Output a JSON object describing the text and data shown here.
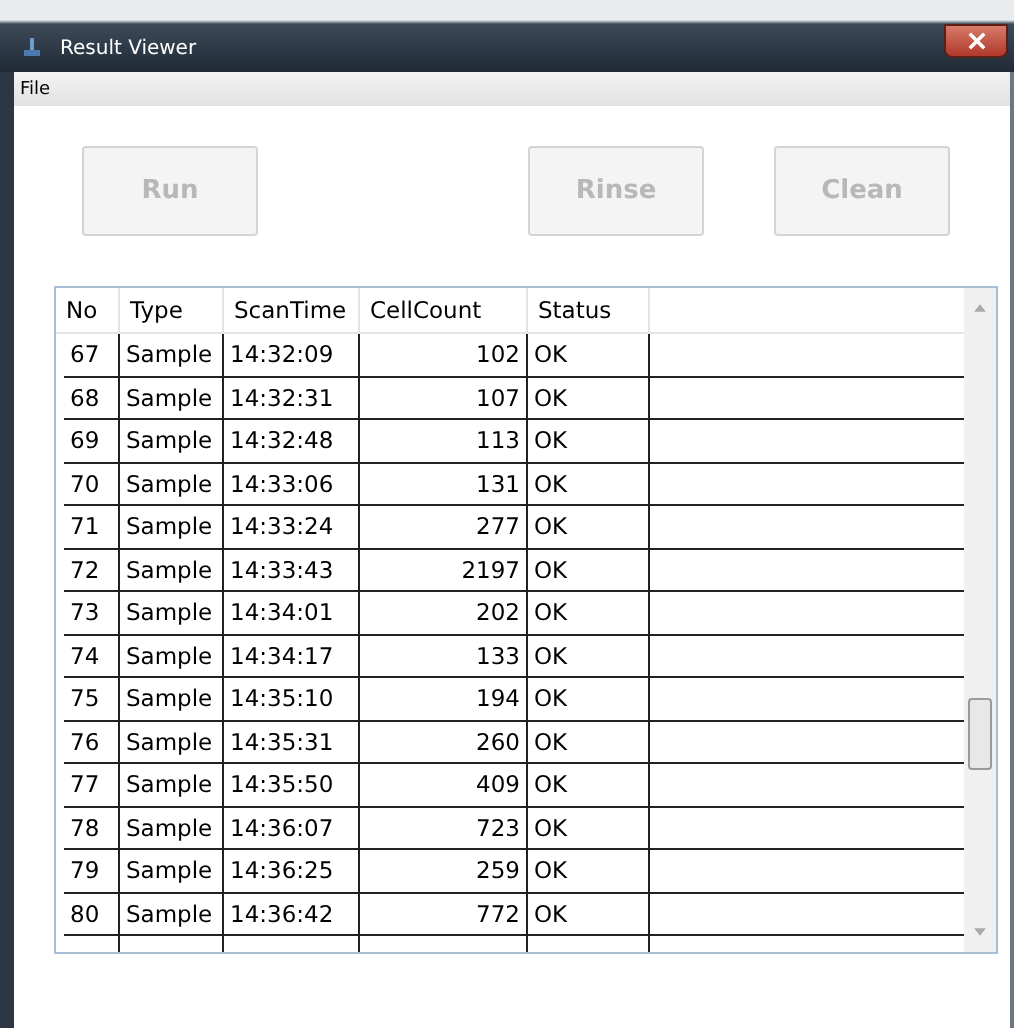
{
  "window": {
    "title": "Result Viewer"
  },
  "menu": [
    {
      "label": "File"
    }
  ],
  "buttons": [
    {
      "label": "Run",
      "disabled": true
    }
  ],
  "right_buttons": [
    {
      "label": "Rinse",
      "disabled": true
    },
    {
      "label": "Clean",
      "disabled": true
    }
  ],
  "table": {
    "columns": [
      "No",
      "Type",
      "ScanTime",
      "CellCount",
      "Status"
    ],
    "rows": [
      [
        "67",
        "Sample",
        "14:32:09",
        "102",
        "OK"
      ],
      [
        "68",
        "Sample",
        "14:32:31",
        "107",
        "OK"
      ],
      [
        "69",
        "Sample",
        "14:32:48",
        "113",
        "OK"
      ],
      [
        "70",
        "Sample",
        "14:33:06",
        "131",
        "OK"
      ],
      [
        "71",
        "Sample",
        "14:33:24",
        "277",
        "OK"
      ],
      [
        "72",
        "Sample",
        "14:33:43",
        "2197",
        "OK"
      ],
      [
        "73",
        "Sample",
        "14:34:01",
        "202",
        "OK"
      ],
      [
        "74",
        "Sample",
        "14:34:17",
        "133",
        "OK"
      ],
      [
        "75",
        "Sample",
        "14:35:10",
        "194",
        "OK"
      ],
      [
        "76",
        "Sample",
        "14:35:31",
        "260",
        "OK"
      ],
      [
        "77",
        "Sample",
        "14:35:50",
        "409",
        "OK"
      ],
      [
        "78",
        "Sample",
        "14:36:07",
        "723",
        "OK"
      ],
      [
        "79",
        "Sample",
        "14:36:25",
        "259",
        "OK"
      ],
      [
        "80",
        "Sample",
        "14:36:42",
        "772",
        "OK"
      ]
    ]
  }
}
